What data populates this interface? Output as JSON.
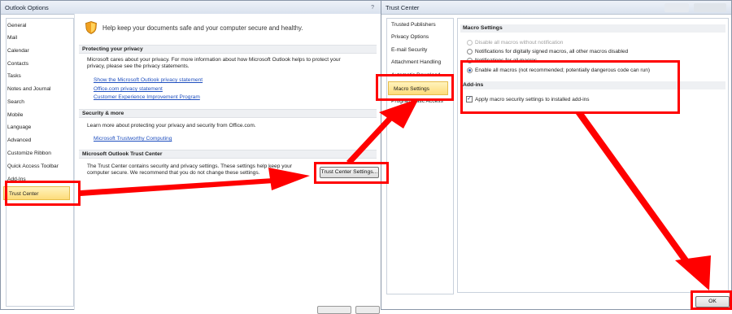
{
  "outlook_options": {
    "title": "Outlook Options",
    "help": "?",
    "nav_items": [
      "General",
      "Mail",
      "Calendar",
      "Contacts",
      "Tasks",
      "Notes and Journal",
      "Search",
      "Mobile",
      "Language",
      "Advanced",
      "Customize Ribbon",
      "Quick Access Toolbar",
      "Add-Ins",
      "Trust Center"
    ],
    "header": "Help keep your documents safe and your computer secure and healthy.",
    "privacy": {
      "title": "Protecting your privacy",
      "text": "Microsoft cares about your privacy. For more information about how Microsoft Outlook helps to protect your privacy, please see the privacy statements.",
      "links": [
        "Show the Microsoft Outlook privacy statement",
        "Office.com privacy statement",
        "Customer Experience Improvement Program"
      ]
    },
    "security": {
      "title": "Security & more",
      "text": "Learn more about protecting your privacy and security from Office.com.",
      "link": "Microsoft Trustworthy Computing"
    },
    "trust_center": {
      "title": "Microsoft Outlook Trust Center",
      "text": "The Trust Center contains security and privacy settings. These settings help keep your computer secure. We recommend that you do not change these settings.",
      "button": "Trust Center Settings..."
    }
  },
  "trust_center_window": {
    "title": "Trust Center",
    "nav_items": [
      "Trusted Publishers",
      "Privacy Options",
      "E-mail Security",
      "Attachment Handling",
      "Automatic Download",
      "Macro Settings",
      "Programmatic Access"
    ],
    "macro_settings": {
      "title": "Macro Settings",
      "options": [
        "Disable all macros without notification",
        "Notifications for digitally signed macros, all other macros disabled",
        "Notifications for all macros",
        "Enable all macros (not recommended; potentially dangerous code can run)"
      ]
    },
    "addins": {
      "title": "Add-ins",
      "checkbox": "Apply macro security settings to installed add-ins",
      "checkmark": "✓"
    },
    "ok": "OK"
  },
  "colors": {
    "annotation": "#ff0000",
    "selection": "#fddc7a",
    "link": "#1f4fbf"
  }
}
